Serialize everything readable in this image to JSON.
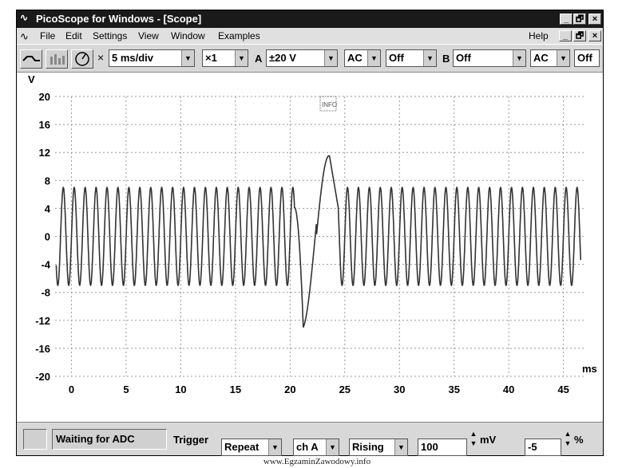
{
  "window": {
    "title": "PicoScope for Windows - [Scope]",
    "minimize": "_",
    "restore": "🗗",
    "close": "×"
  },
  "menu": {
    "items": [
      "File",
      "Edit",
      "Settings",
      "View",
      "Window",
      "Examples"
    ],
    "help": "Help"
  },
  "toolbar": {
    "timebase": "5 ms/div",
    "multiplier": "×1",
    "channel_a_label": "A",
    "channel_a_range": "±20 V",
    "channel_a_coupling": "AC",
    "channel_a_off": "Off",
    "channel_b_label": "B",
    "channel_b_range": "Off",
    "channel_b_coupling": "AC",
    "channel_b_off": "Off"
  },
  "status": {
    "adc_text": "Waiting for ADC",
    "trigger_label": "Trigger",
    "trigger_mode": "Repeat",
    "trigger_channel": "ch A",
    "trigger_edge": "Rising",
    "trigger_level": "100",
    "trigger_level_unit": "mV",
    "trigger_delay": "-5",
    "trigger_delay_unit": "%"
  },
  "footer": "www.EgzaminZawodowy.info",
  "chart_data": {
    "type": "line",
    "title": "",
    "xlabel": "ms",
    "ylabel": "V",
    "xlim": [
      -1.5,
      47
    ],
    "ylim": [
      -20,
      20
    ],
    "xticks": [
      0,
      5,
      10,
      15,
      20,
      25,
      30,
      35,
      40,
      45
    ],
    "yticks": [
      20,
      16,
      12,
      8,
      4,
      0,
      -4,
      -8,
      -12,
      -16,
      -20
    ],
    "grid": true,
    "series": [
      {
        "description_of_shape": "",
        "sine_frequency_khz": 1,
        "sine_amplitude_v": 7,
        "spike_min": {
          "x": 21.2,
          "y": -13
        },
        "spike_max": {
          "x": 23.6,
          "y": 11.5
        },
        "gap_range_ms": [
          20.4,
          24.4
        ],
        "x_end": 46.6
      }
    ]
  }
}
